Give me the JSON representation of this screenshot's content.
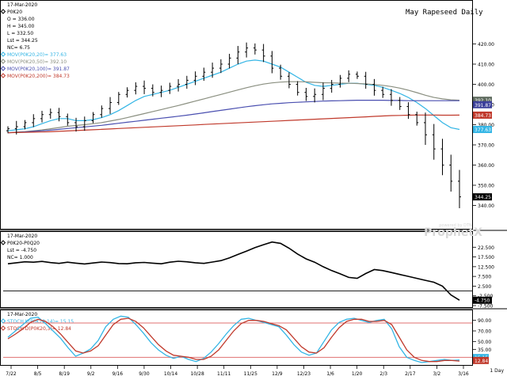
{
  "title": "May Rapeseed Daily",
  "watermark_brand": "ProphetX",
  "watermark_sub": "powered by DTN",
  "timeframe_label": "1 Day",
  "x_tick_labels": [
    "7/22",
    "8/5",
    "8/19",
    "9/2",
    "9/16",
    "9/30",
    "10/14",
    "10/28",
    "11/11",
    "11/25",
    "12/9",
    "12/23",
    "1/6",
    "1/20",
    "2/3",
    "2/17",
    "3/2",
    "3/16"
  ],
  "panels": {
    "price": {
      "legend": [
        {
          "text": "17-Mar-2020",
          "color": "#000000",
          "marker": ""
        },
        {
          "text": "P0K20",
          "color": "#000000",
          "marker": "diamond"
        },
        {
          "text": "O = 336.00",
          "color": "#000000",
          "marker": ""
        },
        {
          "text": "H = 345.00",
          "color": "#000000",
          "marker": ""
        },
        {
          "text": "L = 332.50",
          "color": "#000000",
          "marker": ""
        },
        {
          "text": "Lst = 344.25",
          "color": "#000000",
          "marker": ""
        },
        {
          "text": "NC= 6.75",
          "color": "#000000",
          "marker": ""
        },
        {
          "text": "MOV(P0K20,20)= 377.63",
          "color": "#33b5e5",
          "marker": "diamond"
        },
        {
          "text": "MOV(P0K20,50)= 392.10",
          "color": "#8a8f80",
          "marker": "diamond"
        },
        {
          "text": "MOV(P0K20,100)= 391.87",
          "color": "#4a4fb0",
          "marker": "diamond"
        },
        {
          "text": "MOV(P0K20,200)= 384.73",
          "color": "#c0392b",
          "marker": "diamond"
        }
      ],
      "y_ticks": [
        340,
        350,
        360,
        370,
        380,
        390,
        400,
        410,
        420
      ],
      "value_tags": [
        {
          "text": "392.10",
          "value": 392.1,
          "bg": "#5e6b5e"
        },
        {
          "text": "391.87",
          "value": 389.9,
          "bg": "#3b3f9a"
        },
        {
          "text": "384.73",
          "value": 384.73,
          "bg": "#c0392b"
        },
        {
          "text": "377.63",
          "value": 377.63,
          "bg": "#33b5e5"
        },
        {
          "text": "344.25",
          "value": 344.25,
          "bg": "#000000"
        }
      ]
    },
    "spread": {
      "legend": [
        {
          "text": "17-Mar-2020",
          "color": "#000000",
          "marker": ""
        },
        {
          "text": "P0K20-P0Q20",
          "color": "#000000",
          "marker": "diamond"
        },
        {
          "text": "Lst = -4.750",
          "color": "#000000",
          "marker": ""
        },
        {
          "text": "NC= 1.000",
          "color": "#000000",
          "marker": ""
        }
      ],
      "y_ticks": [
        "22.500",
        "17.500",
        "12.500",
        "7.500",
        "2.500",
        "-2.500",
        "-7.500"
      ],
      "y_tick_values": [
        22.5,
        17.5,
        12.5,
        7.5,
        2.5,
        -2.5,
        -7.5
      ],
      "value_tag": {
        "text": "-4.750",
        "value": -4.75,
        "bg": "#000000"
      }
    },
    "stoch": {
      "legend": [
        {
          "text": "17-Mar-2020",
          "color": "#000000",
          "marker": ""
        },
        {
          "text": "STOCH K(P0K20,14)= 15.15",
          "color": "#33b5e5",
          "marker": "diamond"
        },
        {
          "text": "STOCH D(P0K20,3)= 12.84",
          "color": "#c0392b",
          "marker": "diamond"
        }
      ],
      "y_ticks": [
        "90.00",
        "70.00",
        "50.00",
        "35.00"
      ],
      "y_tick_values": [
        90,
        70,
        50,
        35
      ],
      "value_tags": [
        {
          "text": "15.15",
          "value": 19.5,
          "bg": "#33b5e5"
        },
        {
          "text": "12.84",
          "value": 14.0,
          "bg": "#c0392b"
        }
      ]
    }
  },
  "chart_data": [
    {
      "type": "ohlc",
      "title": "May Rapeseed Daily",
      "ylim": [
        330,
        430
      ],
      "x": [
        "7/22",
        "8/5",
        "8/19",
        "9/2",
        "9/16",
        "9/30",
        "10/14",
        "10/28",
        "11/11",
        "11/25",
        "12/9",
        "12/23",
        "1/6",
        "1/20",
        "2/3",
        "2/17",
        "3/2",
        "3/16"
      ],
      "series": [
        {
          "name": "P0K20",
          "values": [
            378,
            379,
            381,
            383,
            385,
            386,
            384,
            381,
            379,
            382,
            385,
            388,
            391,
            395,
            397,
            399,
            398,
            396,
            397,
            399,
            400,
            402,
            404,
            406,
            408,
            410,
            413,
            416,
            418,
            417,
            414,
            408,
            404,
            400,
            396,
            394,
            395,
            398,
            400,
            403,
            405,
            404,
            400,
            397,
            395,
            392,
            389,
            385,
            381,
            375,
            368,
            360,
            352,
            344.25
          ]
        },
        {
          "name": "MOV(P0K20,20)",
          "values": [
            377,
            377.5,
            378,
            379,
            380.5,
            382,
            383,
            383,
            382,
            382,
            382.5,
            383.5,
            385,
            387,
            389.5,
            392,
            394,
            395,
            396,
            397,
            398.5,
            400,
            401.5,
            403,
            404.5,
            406,
            408,
            410,
            411.5,
            412,
            411.5,
            410,
            408.5,
            406,
            403.5,
            401,
            399.5,
            399,
            399.5,
            400,
            400.5,
            400.5,
            400,
            399.5,
            398.5,
            397,
            395.5,
            393.5,
            391,
            388,
            384.5,
            381,
            378.5,
            377.63
          ]
        },
        {
          "name": "MOV(P0K20,50)",
          "values": [
            376,
            376.3,
            376.6,
            377,
            377.4,
            378,
            378.6,
            379.2,
            379.6,
            380,
            380.5,
            381,
            381.8,
            382.6,
            383.5,
            384.5,
            385.5,
            386.5,
            387.5,
            388.5,
            389.5,
            390.6,
            391.7,
            392.8,
            393.9,
            395,
            396.1,
            397.2,
            398.3,
            399.3,
            400.1,
            400.7,
            401.1,
            401.3,
            401.3,
            401.2,
            401,
            400.8,
            400.7,
            400.6,
            400.5,
            400.4,
            400.2,
            399.9,
            399.5,
            398.9,
            398.1,
            397.1,
            395.9,
            394.6,
            393.5,
            392.8,
            392.3,
            392.1
          ]
        },
        {
          "name": "MOV(P0K20,100)",
          "values": [
            376,
            376.2,
            376.4,
            376.7,
            377,
            377.3,
            377.7,
            378.1,
            378.5,
            378.9,
            379.3,
            379.7,
            380.2,
            380.7,
            381.2,
            381.7,
            382.2,
            382.7,
            383.2,
            383.7,
            384.2,
            384.7,
            385.3,
            385.9,
            386.5,
            387.1,
            387.7,
            388.3,
            388.9,
            389.4,
            389.9,
            390.3,
            390.6,
            390.9,
            391.1,
            391.3,
            391.5,
            391.7,
            391.8,
            391.9,
            392,
            392.1,
            392.1,
            392.1,
            392.1,
            392,
            392,
            391.9,
            391.9,
            391.9,
            391.9,
            391.9,
            391.9,
            391.87
          ]
        },
        {
          "name": "MOV(P0K20,200)",
          "values": [
            376,
            376.1,
            376.2,
            376.3,
            376.4,
            376.5,
            376.7,
            376.9,
            377.1,
            377.3,
            377.5,
            377.7,
            377.9,
            378.1,
            378.3,
            378.5,
            378.7,
            378.9,
            379.1,
            379.3,
            379.5,
            379.7,
            379.9,
            380.1,
            380.3,
            380.5,
            380.7,
            380.9,
            381.1,
            381.3,
            381.5,
            381.7,
            381.9,
            382.1,
            382.3,
            382.5,
            382.7,
            382.9,
            383.1,
            383.3,
            383.5,
            383.7,
            383.9,
            384.1,
            384.3,
            384.5,
            384.6,
            384.7,
            384.8,
            384.8,
            384.8,
            384.7,
            384.7,
            384.73
          ]
        }
      ]
    },
    {
      "type": "line",
      "title": "",
      "ylim": [
        -7.5,
        27.5
      ],
      "x": [
        "7/22",
        "8/5",
        "8/19",
        "9/2",
        "9/16",
        "9/30",
        "10/14",
        "10/28",
        "11/11",
        "11/25",
        "12/9",
        "12/23",
        "1/6",
        "1/20",
        "2/3",
        "2/17",
        "3/2",
        "3/16"
      ],
      "series": [
        {
          "name": "P0K20-P0Q20",
          "values": [
            14,
            14.5,
            15,
            14.8,
            15.2,
            14.6,
            14.2,
            14.8,
            14.3,
            13.9,
            14.4,
            14.9,
            14.6,
            14.1,
            14,
            14.5,
            14.7,
            14.3,
            14,
            14.8,
            15.3,
            15,
            14.5,
            14.2,
            14.9,
            15.6,
            17,
            18.8,
            20.5,
            22.3,
            23.8,
            25.2,
            24.5,
            22,
            19,
            16.5,
            14.8,
            12.5,
            10.5,
            8.8,
            7,
            6.5,
            9,
            11,
            10.5,
            9.5,
            8.5,
            7.5,
            6.5,
            5.5,
            4.5,
            2.5,
            -2,
            -4.75
          ]
        }
      ],
      "reference_line": 0
    },
    {
      "type": "line",
      "title": "",
      "ylim": [
        10,
        100
      ],
      "x": [
        "7/22",
        "8/5",
        "8/19",
        "9/2",
        "9/16",
        "9/30",
        "10/14",
        "10/28",
        "11/11",
        "11/25",
        "12/9",
        "12/23",
        "1/6",
        "1/20",
        "2/3",
        "2/17",
        "3/2",
        "3/16"
      ],
      "reference_lines": [
        85,
        20
      ],
      "series": [
        {
          "name": "STOCH K(P0K20,14)",
          "values": [
            58,
            70,
            82,
            94,
            96,
            84,
            70,
            56,
            38,
            22,
            28,
            36,
            52,
            78,
            92,
            98,
            96,
            82,
            66,
            48,
            34,
            24,
            18,
            22,
            16,
            12,
            18,
            30,
            46,
            64,
            80,
            92,
            94,
            90,
            86,
            82,
            78,
            62,
            44,
            30,
            24,
            28,
            50,
            72,
            86,
            92,
            94,
            90,
            86,
            90,
            92,
            74,
            40,
            20,
            14,
            10,
            12,
            14,
            16,
            14,
            15.15
          ]
        },
        {
          "name": "STOCH D(P0K20,3)",
          "values": [
            55,
            64,
            74,
            86,
            92,
            88,
            78,
            64,
            48,
            32,
            28,
            32,
            42,
            62,
            82,
            92,
            94,
            88,
            76,
            60,
            44,
            32,
            24,
            22,
            20,
            16,
            16,
            22,
            34,
            52,
            70,
            84,
            90,
            90,
            88,
            84,
            80,
            72,
            56,
            40,
            30,
            28,
            38,
            58,
            76,
            88,
            92,
            92,
            88,
            88,
            90,
            82,
            58,
            34,
            20,
            14,
            12,
            12,
            14,
            14,
            12.84
          ]
        }
      ]
    }
  ]
}
